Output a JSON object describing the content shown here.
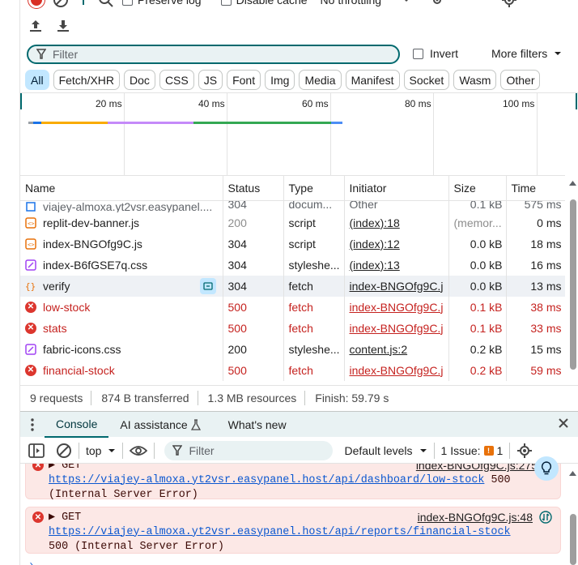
{
  "toolbar": {
    "preserve_log_label": "Preserve log",
    "disable_cache_label": "Disable cache",
    "throttling_value": "No throttling"
  },
  "filter": {
    "placeholder": "Filter",
    "invert_label": "Invert",
    "more_filters_label": "More filters"
  },
  "type_chips": [
    "All",
    "Fetch/XHR",
    "Doc",
    "CSS",
    "JS",
    "Font",
    "Img",
    "Media",
    "Manifest",
    "Socket",
    "Wasm",
    "Other"
  ],
  "overview": {
    "ticks": [
      "20 ms",
      "40 ms",
      "60 ms",
      "80 ms",
      "100 ms"
    ]
  },
  "table": {
    "columns": [
      "Name",
      "Status",
      "Type",
      "Initiator",
      "Size",
      "Time"
    ],
    "partial_row": {
      "name": "viajey-almoxa.yt2vsr.easypanel....",
      "status": "304",
      "type": "docum...",
      "initiator": "Other",
      "size": "0.1 kB",
      "time": "575 ms"
    },
    "rows": [
      {
        "name": "replit-dev-banner.js",
        "status": "200",
        "type": "script",
        "initiator": "(index):18",
        "size": "(memor...",
        "time": "0 ms",
        "icon": "script-icon",
        "error": false
      },
      {
        "name": "index-BNGOfg9C.js",
        "status": "304",
        "type": "script",
        "initiator": "(index):12",
        "size": "0.0 kB",
        "time": "18 ms",
        "icon": "script-icon",
        "error": false
      },
      {
        "name": "index-B6fGSE7q.css",
        "status": "304",
        "type": "styleshe...",
        "initiator": "(index):13",
        "size": "0.0 kB",
        "time": "16 ms",
        "icon": "stylesheet-icon",
        "error": false
      },
      {
        "name": "verify",
        "status": "304",
        "type": "fetch",
        "initiator": "index-BNGOfg9C.j",
        "size": "0.0 kB",
        "time": "13 ms",
        "icon": "fetch-icon",
        "error": false
      },
      {
        "name": "low-stock",
        "status": "500",
        "type": "fetch",
        "initiator": "index-BNGOfg9C.j",
        "size": "0.1 kB",
        "time": "38 ms",
        "icon": "error-icon",
        "error": true
      },
      {
        "name": "stats",
        "status": "500",
        "type": "fetch",
        "initiator": "index-BNGOfg9C.j",
        "size": "0.1 kB",
        "time": "33 ms",
        "icon": "error-icon",
        "error": true
      },
      {
        "name": "fabric-icons.css",
        "status": "200",
        "type": "styleshe...",
        "initiator": "content.js:2",
        "size": "0.2 kB",
        "time": "15 ms",
        "icon": "stylesheet-icon",
        "error": false
      },
      {
        "name": "financial-stock",
        "status": "500",
        "type": "fetch",
        "initiator": "index-BNGOfg9C.j",
        "size": "0.2 kB",
        "time": "59 ms",
        "icon": "error-icon",
        "error": true
      }
    ]
  },
  "summary": {
    "requests": "9 requests",
    "transferred": "874 B transferred",
    "resources": "1.3 MB resources",
    "finish": "Finish: 59.79 s"
  },
  "drawer": {
    "tabs": [
      "Console",
      "AI assistance",
      "What's new"
    ],
    "context": "top",
    "filter_placeholder": "Filter",
    "levels": "Default levels",
    "issues_label": "1 Issue:",
    "issues_count": "1"
  },
  "console": {
    "messages": [
      {
        "method": "GET",
        "source": "index-BNGOfg9C.js:275",
        "url": "https://viajey-almoxa.yt2vsr.easypanel.host/api/dashboard/low-stock",
        "status_code": "500",
        "status_text": "(Internal Server Error)"
      },
      {
        "method": "GET",
        "source": "index-BNGOfg9C.js:48",
        "url": "https://viajey-almoxa.yt2vsr.easypanel.host/api/reports/financial-stock",
        "status_code": "",
        "status_text": "500 (Internal Server Error)"
      }
    ]
  },
  "colors": {
    "error": "#c5221f",
    "accent": "#00696e",
    "active_chip": "#c2e7ff",
    "error_bg": "#fce8e6"
  }
}
